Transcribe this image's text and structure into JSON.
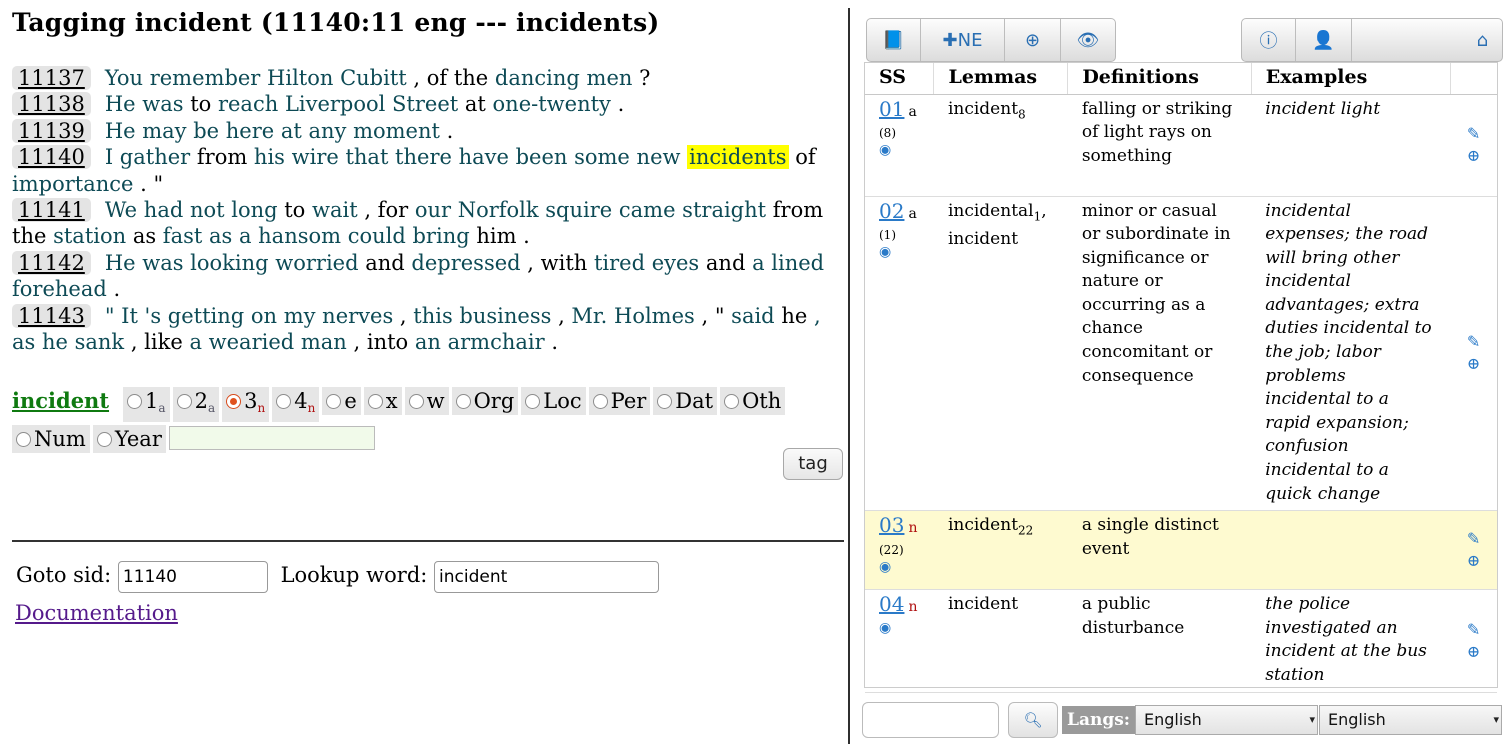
{
  "page_title": "Tagging incident (11140:11 eng --- incidents)",
  "sentences": [
    {
      "sid": "11137",
      "tokens": [
        {
          "t": "You",
          "c": "w"
        },
        {
          "t": " ",
          "c": ""
        },
        {
          "t": "remember",
          "c": "w"
        },
        {
          "t": " ",
          "c": ""
        },
        {
          "t": "Hilton Cubitt",
          "c": "w"
        },
        {
          "t": " , ",
          "c": "b"
        },
        {
          "t": "of",
          "c": "b"
        },
        {
          "t": " the ",
          "c": "b"
        },
        {
          "t": "dancing men",
          "c": "w"
        },
        {
          "t": " ?",
          "c": "b"
        }
      ]
    },
    {
      "sid": "11138",
      "tokens": [
        {
          "t": "He",
          "c": "w"
        },
        {
          "t": " was ",
          "c": "w"
        },
        {
          "t": "to",
          "c": "b"
        },
        {
          "t": " ",
          "c": ""
        },
        {
          "t": "reach",
          "c": "w"
        },
        {
          "t": " ",
          "c": ""
        },
        {
          "t": "Liverpool Street",
          "c": "w"
        },
        {
          "t": " at ",
          "c": "b"
        },
        {
          "t": "one-twenty",
          "c": "w"
        },
        {
          "t": " .",
          "c": "b"
        }
      ]
    },
    {
      "sid": "11139",
      "tokens": [
        {
          "t": "He",
          "c": "w"
        },
        {
          "t": " may be here ",
          "c": "w"
        },
        {
          "t": "at any moment",
          "c": "w"
        },
        {
          "t": " .",
          "c": "b"
        }
      ]
    },
    {
      "sid": "11140",
      "tokens": [
        {
          "t": "I",
          "c": "w"
        },
        {
          "t": " ",
          "c": ""
        },
        {
          "t": "gather",
          "c": "w"
        },
        {
          "t": " from ",
          "c": "b"
        },
        {
          "t": "his",
          "c": "w"
        },
        {
          "t": " wire that there have been some new ",
          "c": "w"
        },
        {
          "t": "incidents",
          "c": "hl"
        },
        {
          "t": " ",
          "c": ""
        },
        {
          "t": "of",
          "c": "b"
        },
        {
          "t": " importance",
          "c": "w"
        },
        {
          "t": " . \"",
          "c": "b"
        }
      ]
    },
    {
      "sid": "11141",
      "tokens": [
        {
          "t": "We had not long",
          "c": "w"
        },
        {
          "t": " to ",
          "c": "b"
        },
        {
          "t": "wait",
          "c": "w"
        },
        {
          "t": " , for ",
          "c": "b"
        },
        {
          "t": "our Norfolk squire came straight",
          "c": "w"
        },
        {
          "t": " from the ",
          "c": "b"
        },
        {
          "t": "station",
          "c": "w"
        },
        {
          "t": " as ",
          "c": "b"
        },
        {
          "t": "fast as a hansom could bring",
          "c": "w"
        },
        {
          "t": " him",
          "c": "b"
        },
        {
          "t": " .",
          "c": "b"
        }
      ]
    },
    {
      "sid": "11142",
      "tokens": [
        {
          "t": "He was looking worried",
          "c": "w"
        },
        {
          "t": " and ",
          "c": "b"
        },
        {
          "t": "depressed",
          "c": "w"
        },
        {
          "t": " , with ",
          "c": "b"
        },
        {
          "t": "tired eyes",
          "c": "w"
        },
        {
          "t": " and ",
          "c": "b"
        },
        {
          "t": "a",
          "c": "w"
        },
        {
          "t": " ",
          "c": ""
        },
        {
          "t": "lined forehead",
          "c": "w"
        },
        {
          "t": " .",
          "c": "b"
        }
      ]
    },
    {
      "sid": "11143",
      "tokens": [
        {
          "t": "\" It 's getting on my nerves",
          "c": "w"
        },
        {
          "t": " , ",
          "c": "b"
        },
        {
          "t": "this business",
          "c": "w"
        },
        {
          "t": " , ",
          "c": "b"
        },
        {
          "t": "Mr. Holmes",
          "c": "w"
        },
        {
          "t": " , \" ",
          "c": "b"
        },
        {
          "t": "said",
          "c": "w"
        },
        {
          "t": " he",
          "c": "b"
        },
        {
          "t": " , as he ",
          "c": "w"
        },
        {
          "t": "sank",
          "c": "w"
        },
        {
          "t": " , like ",
          "c": "b"
        },
        {
          "t": "a wearied man",
          "c": "w"
        },
        {
          "t": " , into ",
          "c": "b"
        },
        {
          "t": "an armchair",
          "c": "w"
        },
        {
          "t": " .",
          "c": "b"
        }
      ]
    }
  ],
  "tagging": {
    "lemma": "incident",
    "options": [
      {
        "label": "1",
        "sub": "a",
        "subclass": "",
        "checked": false
      },
      {
        "label": "2",
        "sub": "a",
        "subclass": "",
        "checked": false
      },
      {
        "label": "3",
        "sub": "n",
        "subclass": "n",
        "checked": true
      },
      {
        "label": "4",
        "sub": "n",
        "subclass": "n",
        "checked": false
      },
      {
        "label": "e",
        "sub": "",
        "subclass": "",
        "checked": false
      },
      {
        "label": "x",
        "sub": "",
        "subclass": "",
        "checked": false
      },
      {
        "label": "w",
        "sub": "",
        "subclass": "",
        "checked": false
      },
      {
        "label": "Org",
        "sub": "",
        "subclass": "",
        "checked": false
      },
      {
        "label": "Loc",
        "sub": "",
        "subclass": "",
        "checked": false
      },
      {
        "label": "Per",
        "sub": "",
        "subclass": "",
        "checked": false
      },
      {
        "label": "Dat",
        "sub": "",
        "subclass": "",
        "checked": false
      },
      {
        "label": "Oth",
        "sub": "",
        "subclass": "",
        "checked": false
      },
      {
        "label": "Num",
        "sub": "",
        "subclass": "",
        "checked": false
      },
      {
        "label": "Year",
        "sub": "",
        "subclass": "",
        "checked": false
      }
    ],
    "comment_value": "",
    "tag_button": "tag"
  },
  "goto": {
    "label": "Goto sid:",
    "value": "11140",
    "lookup_label": "Lookup word:",
    "lookup_value": "incident"
  },
  "documentation_link": "Documentation",
  "toolbar": {
    "left": [
      {
        "icon": "book-icon",
        "glyph": "📘",
        "text": ""
      },
      {
        "icon": "plus-icon",
        "glyph": "✚",
        "text": "NE"
      },
      {
        "icon": "plus-circle-icon",
        "glyph": "⊕",
        "text": ""
      },
      {
        "icon": "eye-icon",
        "glyph": "👁",
        "text": ""
      }
    ],
    "right": [
      {
        "icon": "info-icon",
        "glyph": "ⓘ",
        "text": ""
      },
      {
        "icon": "user-icon",
        "glyph": "👤",
        "text": ""
      },
      {
        "icon": "home-icon",
        "glyph": "⌂",
        "text": ""
      }
    ]
  },
  "senses_table": {
    "headers": [
      "SS",
      "Lemmas",
      "Definitions",
      "Examples"
    ],
    "rows": [
      {
        "ss": "01",
        "pos": "a",
        "pos_class": "",
        "freq": "(8)",
        "lemmas": [
          {
            "text": "incident",
            "sub": "8"
          }
        ],
        "definition": "falling or striking of light rays on something",
        "example": "incident light",
        "selected": false
      },
      {
        "ss": "02",
        "pos": "a",
        "pos_class": "",
        "freq": "(1)",
        "lemmas": [
          {
            "text": "incidental",
            "sub": "1"
          },
          {
            "text": "incident",
            "sub": ""
          }
        ],
        "definition": "minor or casual or subordinate in significance or nature or occurring as a chance concomitant or consequence",
        "example": "incidental expenses; the road will bring other incidental advantages; extra duties incidental to the job; labor problems incidental to a rapid expansion; confusion incidental to a quick change",
        "selected": false
      },
      {
        "ss": "03",
        "pos": "n",
        "pos_class": "n",
        "freq": "(22)",
        "lemmas": [
          {
            "text": "incident",
            "sub": "22"
          }
        ],
        "definition": "a single distinct event",
        "example": "",
        "selected": true
      },
      {
        "ss": "04",
        "pos": "n",
        "pos_class": "n",
        "freq": "",
        "lemmas": [
          {
            "text": "incident",
            "sub": ""
          }
        ],
        "definition": "a public disturbance",
        "example": "the police investigated an incident at the bus station",
        "selected": false
      }
    ]
  },
  "bottom": {
    "search_value": "",
    "langs_label": "Langs:",
    "lang1": "English",
    "lang2": "English"
  },
  "colors": {
    "word_link": "#0d4a55",
    "highlight": "#ffff00",
    "lemma_green": "#0f7a10",
    "selected_row": "#fefad0",
    "icon_blue": "#2a7ac8"
  }
}
